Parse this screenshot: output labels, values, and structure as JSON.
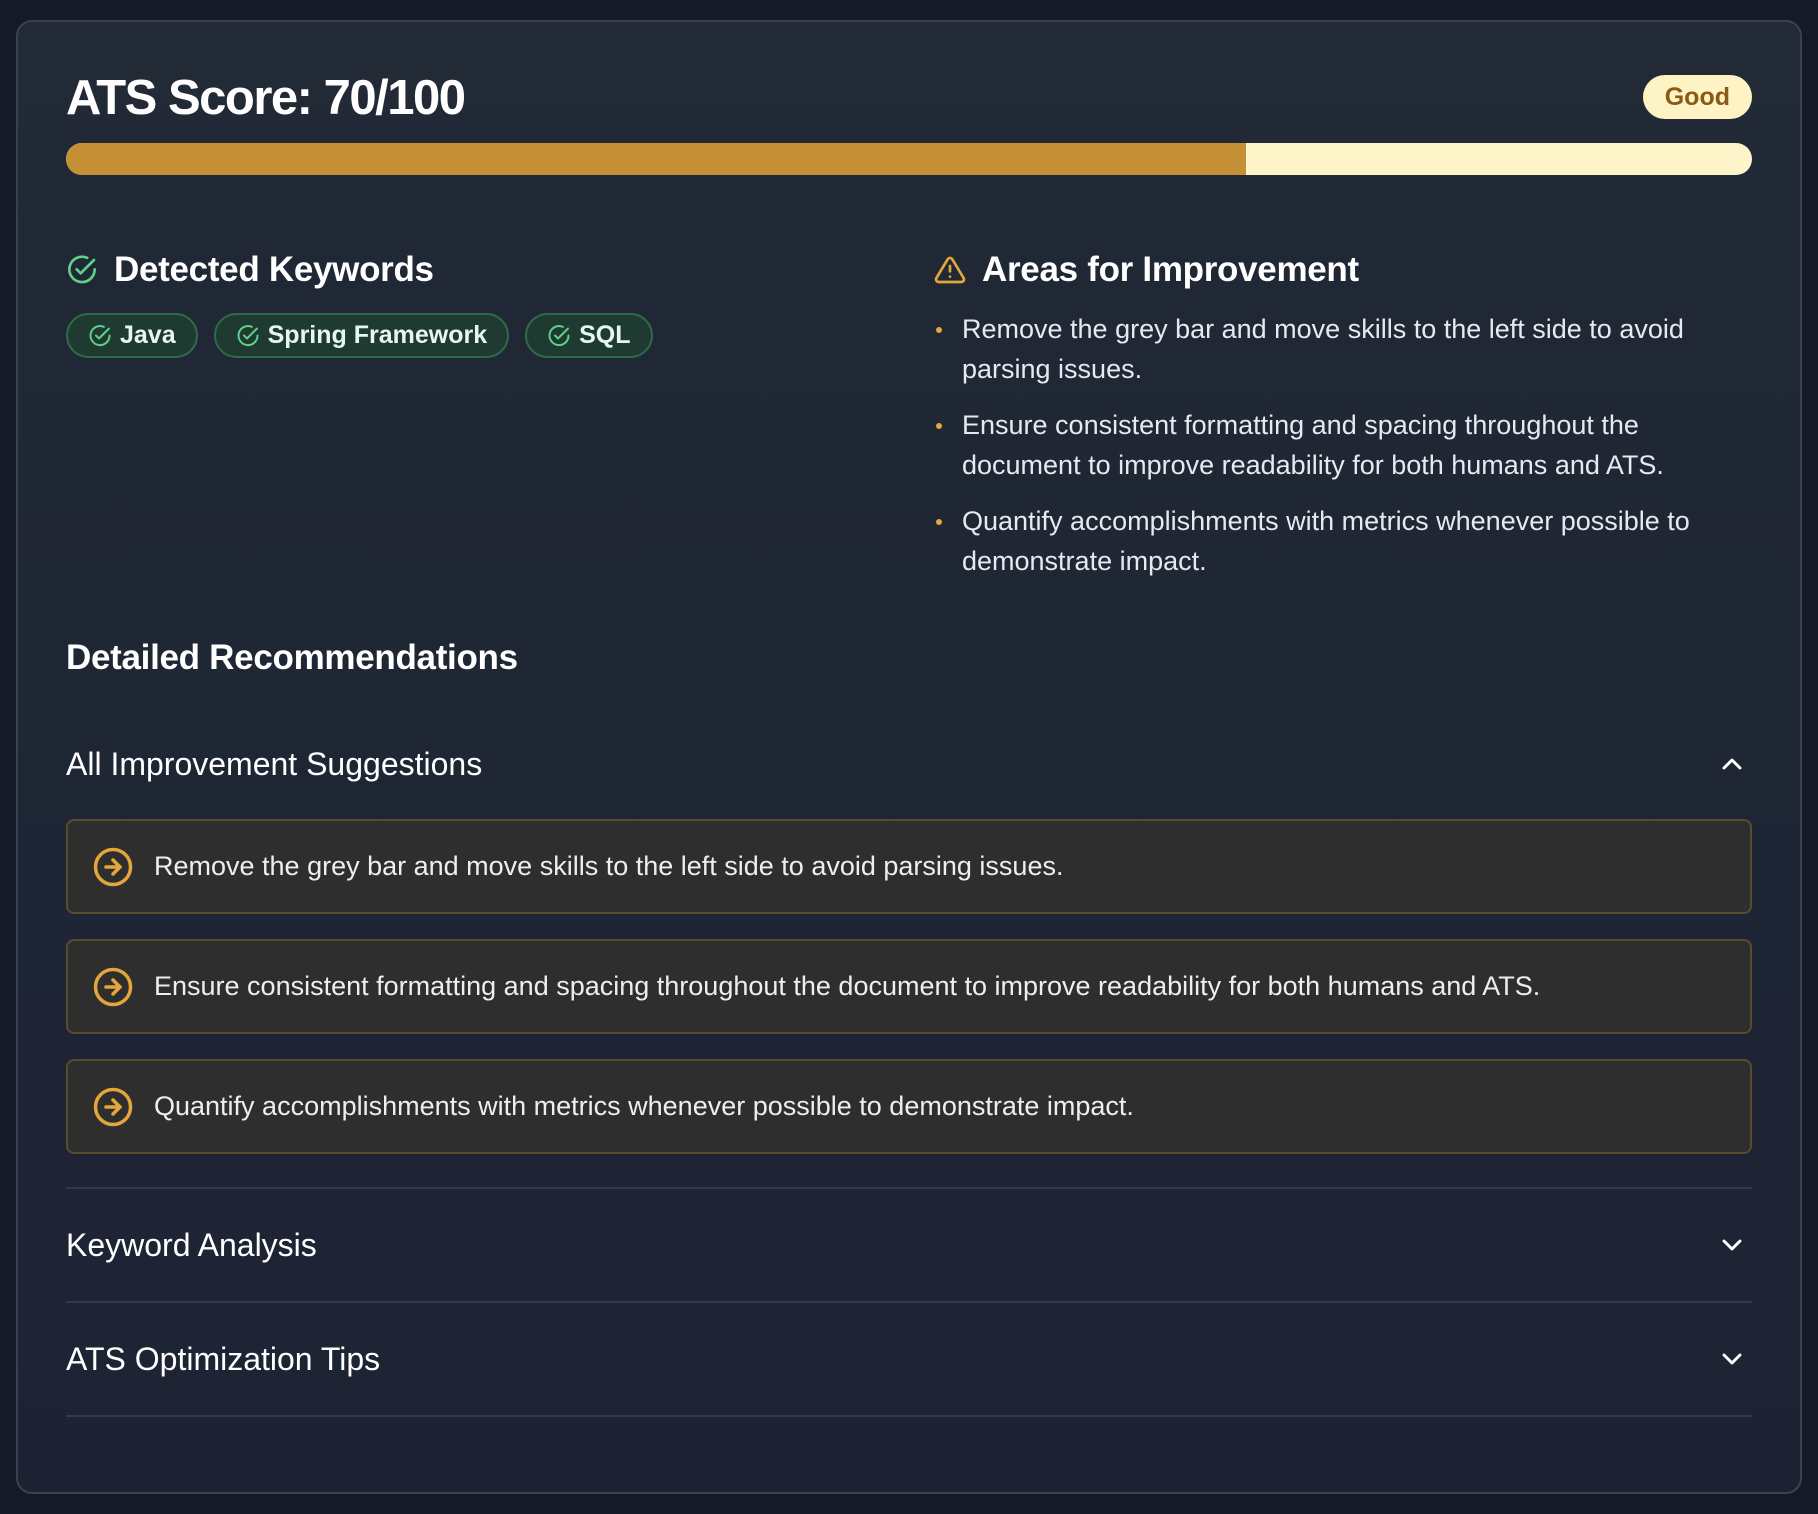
{
  "score": {
    "title": "ATS Score: 70/100",
    "value": 70,
    "max": 100,
    "badge": "Good",
    "fill_color": "#c48f35",
    "track_color": "#fdf5c9"
  },
  "keywords": {
    "title": "Detected Keywords",
    "icon": "check-circle-icon",
    "items": [
      "Java",
      "Spring Framework",
      "SQL"
    ]
  },
  "improvements": {
    "title": "Areas for Improvement",
    "icon": "warning-triangle-icon",
    "items": [
      "Remove the grey bar and move skills to the left side to avoid parsing issues.",
      "Ensure consistent formatting and spacing throughout the document to improve readability for both humans and ATS.",
      "Quantify accomplishments with metrics whenever possible to demonstrate impact."
    ]
  },
  "recommendations": {
    "title": "Detailed Recommendations",
    "sections": [
      {
        "label": "All Improvement Suggestions",
        "expanded": true,
        "icon": "chevron-up-icon",
        "items": [
          "Remove the grey bar and move skills to the left side to avoid parsing issues.",
          "Ensure consistent formatting and spacing throughout the document to improve readability for both humans and ATS.",
          "Quantify accomplishments with metrics whenever possible to demonstrate impact."
        ]
      },
      {
        "label": "Keyword Analysis",
        "expanded": false,
        "icon": "chevron-down-icon"
      },
      {
        "label": "ATS Optimization Tips",
        "expanded": false,
        "icon": "chevron-down-icon"
      }
    ]
  },
  "colors": {
    "accent_orange": "#e3a63a",
    "success_green": "#5fd08a",
    "badge_bg": "#fdf3c4"
  }
}
